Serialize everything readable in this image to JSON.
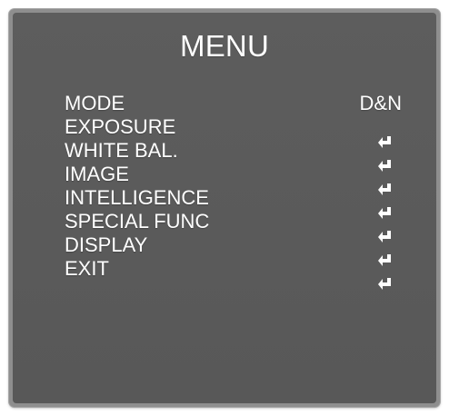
{
  "menu": {
    "title": "MENU",
    "items": [
      {
        "label": "MODE",
        "value": "D&N"
      },
      {
        "label": "EXPOSURE"
      },
      {
        "label": "WHITE BAL."
      },
      {
        "label": "IMAGE"
      },
      {
        "label": "INTELLIGENCE"
      },
      {
        "label": "SPECIAL FUNC"
      },
      {
        "label": "DISPLAY"
      },
      {
        "label": "EXIT"
      }
    ],
    "return_icons": [
      "return-arrow-icon",
      "return-arrow-icon",
      "return-arrow-icon",
      "return-arrow-icon",
      "return-arrow-icon",
      "return-arrow-icon",
      "return-arrow-icon"
    ]
  },
  "colors": {
    "panel": "#5b5b5b",
    "frame": "#8e8e8e",
    "text": "#ffffff"
  }
}
